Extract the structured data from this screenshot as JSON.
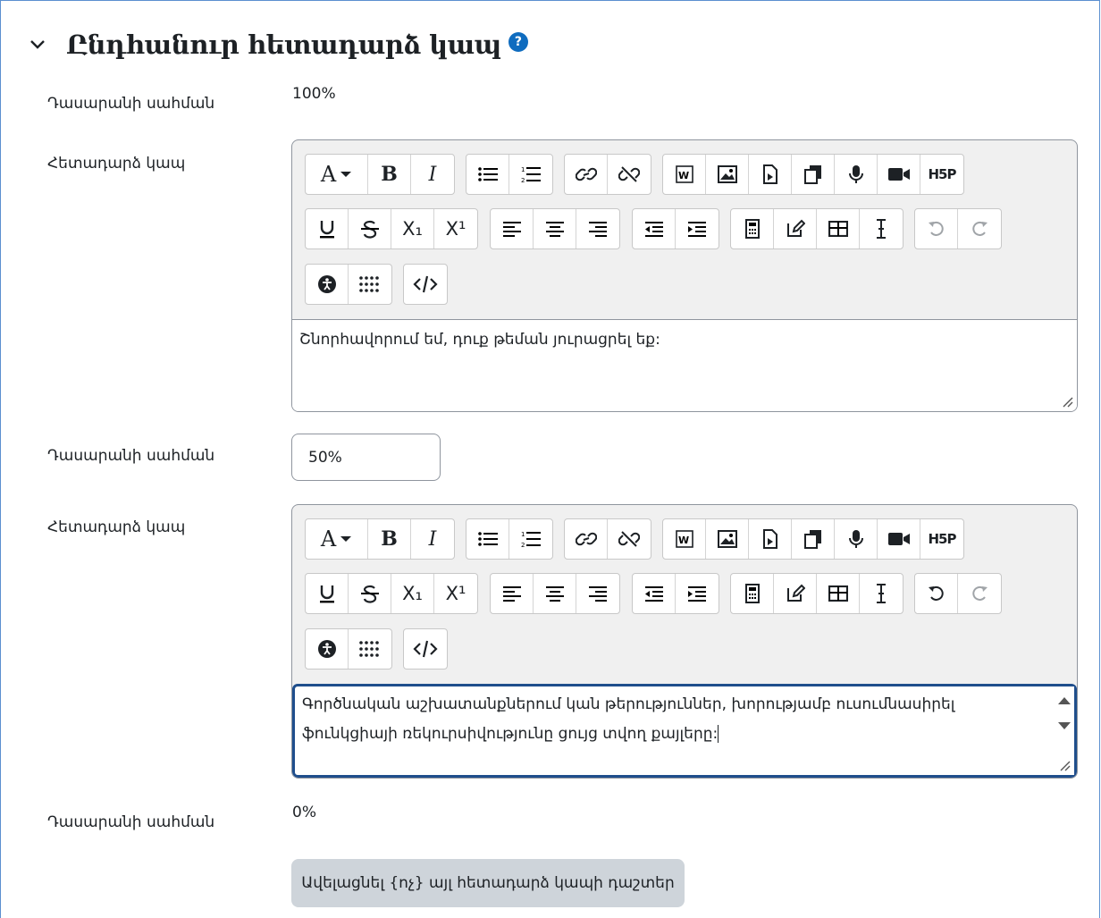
{
  "section": {
    "title": "Ընդհանուր հետադարձ կապ",
    "help_glyph": "?",
    "colors": {
      "help": "#0f6cbf",
      "focus": "#1f4e8c"
    }
  },
  "rows": [
    {
      "label": "Դասարանի սահման",
      "value": "100%"
    },
    {
      "label": "Հետադարձ կապ",
      "content": "Շնորհավորում եմ, դուք թեման յուրացրել եք:"
    },
    {
      "label": "Դասարանի սահման",
      "value": "50%"
    },
    {
      "label": "Հետադարձ կապ",
      "content_line1": "Գործնական աշխատանքներում կան թերություններ, խորությամբ ուսումնասիրել",
      "content_line2": "ֆունկցիայի ռեկուրսիվությունը ցույց տվող քայլերը:"
    },
    {
      "label": "Դասարանի սահման",
      "value": "0%"
    }
  ],
  "toolbar": {
    "font_label": "A",
    "bold": "B",
    "italic": "I",
    "subscript": "X₁",
    "superscript": "X¹",
    "h5p": "H5P"
  },
  "add_button": "Ավելացնել {ոչ} այլ հետադարձ կապի դաշտեր"
}
